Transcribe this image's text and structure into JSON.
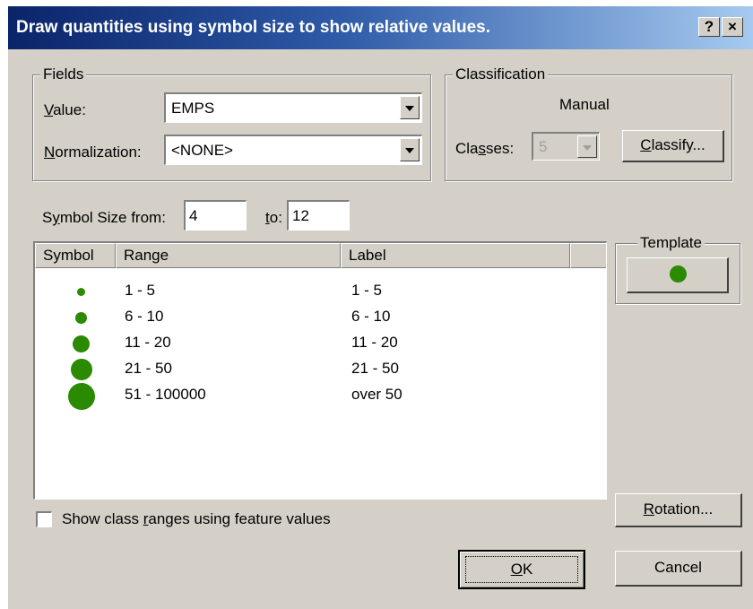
{
  "dialog": {
    "title": "Draw quantities using symbol size to show relative values.",
    "help_label": "?",
    "close_label": "×"
  },
  "fields": {
    "group_title": "Fields",
    "value_label": "Value:",
    "value_selected": "EMPS",
    "normalization_label": "Normalization:",
    "normalization_selected": "<NONE>"
  },
  "classification": {
    "group_title": "Classification",
    "method": "Manual",
    "classes_label": "Classes:",
    "classes_value": "5",
    "classify_label": "Classify..."
  },
  "symbol_size": {
    "from_label": "Symbol Size from:",
    "from_value": "4",
    "to_label": "to:",
    "to_value": "12"
  },
  "table": {
    "columns": [
      "Symbol",
      "Range",
      "Label"
    ],
    "rows": [
      {
        "range": "1 - 5",
        "label": "1 - 5"
      },
      {
        "range": "6 - 10",
        "label": "6 - 10"
      },
      {
        "range": "11 - 20",
        "label": "11 - 20"
      },
      {
        "range": "21 - 50",
        "label": "21 - 50"
      },
      {
        "range": "51 - 100000",
        "label": "over 50"
      }
    ],
    "symbol_color": "#2a8a00"
  },
  "template": {
    "group_title": "Template",
    "symbol_color": "#2a8a00"
  },
  "checkbox": {
    "label": "Show class ranges using feature values",
    "checked": false
  },
  "buttons": {
    "rotation": "Rotation...",
    "ok": "OK",
    "cancel": "Cancel"
  }
}
